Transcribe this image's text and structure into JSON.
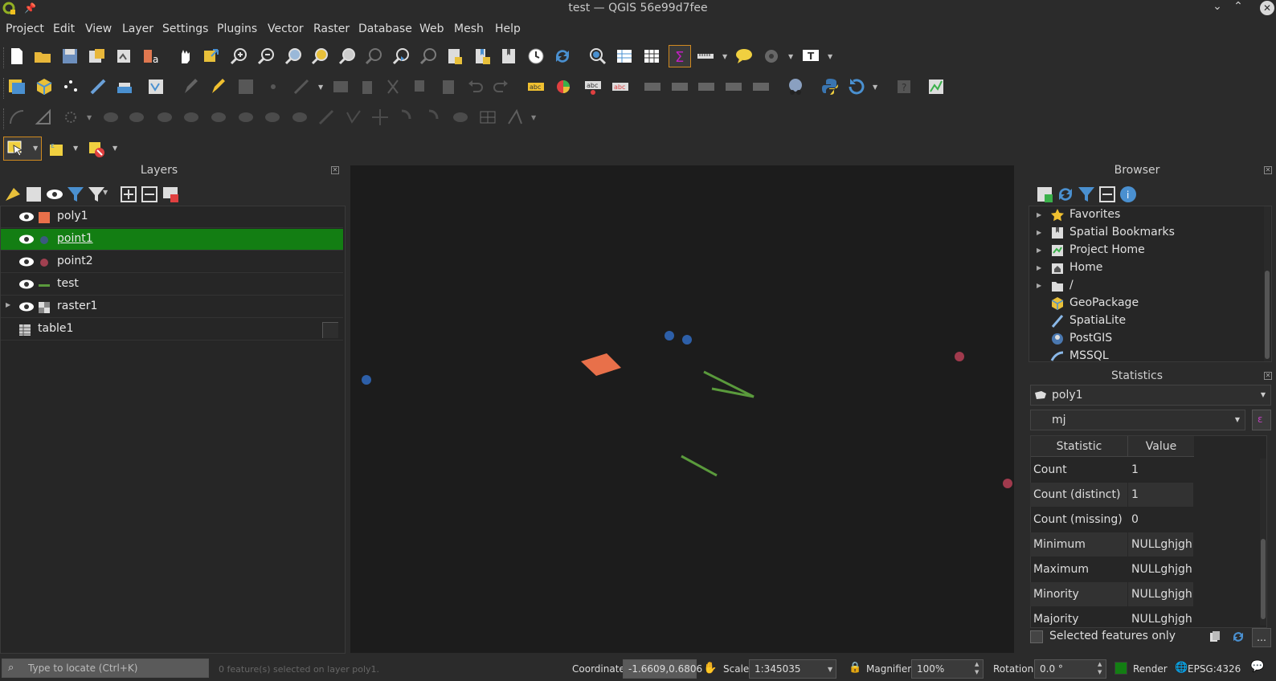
{
  "window": {
    "title": "test — QGIS 56e99d7fee"
  },
  "menu": [
    "Project",
    "Edit",
    "View",
    "Layer",
    "Settings",
    "Plugins",
    "Vector",
    "Raster",
    "Database",
    "Web",
    "Mesh",
    "Help"
  ],
  "layers_panel": {
    "title": "Layers",
    "layers": [
      {
        "name": "poly1",
        "symbol": "polygon",
        "color": "#e8704a",
        "visible": true,
        "selected": false
      },
      {
        "name": "point1",
        "symbol": "point",
        "color": "#3b6ec9",
        "visible": true,
        "selected": true
      },
      {
        "name": "point2",
        "symbol": "point",
        "color": "#a04050",
        "visible": true,
        "selected": false
      },
      {
        "name": "test",
        "symbol": "line",
        "color": "#5a9a3c",
        "visible": true,
        "selected": false
      },
      {
        "name": "raster1",
        "symbol": "raster",
        "color": "#cccccc",
        "visible": true,
        "selected": false
      },
      {
        "name": "table1",
        "symbol": "table",
        "color": "#cccccc",
        "visible": false,
        "selected": false
      }
    ]
  },
  "browser_panel": {
    "title": "Browser",
    "items": [
      {
        "label": "Favorites",
        "icon": "star-icon",
        "expandable": true
      },
      {
        "label": "Spatial Bookmarks",
        "icon": "bookmark-icon",
        "expandable": true
      },
      {
        "label": "Project Home",
        "icon": "project-home-icon",
        "expandable": true
      },
      {
        "label": "Home",
        "icon": "home-icon",
        "expandable": true
      },
      {
        "label": "/",
        "icon": "folder-icon",
        "expandable": true
      },
      {
        "label": "GeoPackage",
        "icon": "geopackage-icon",
        "expandable": false
      },
      {
        "label": "SpatiaLite",
        "icon": "spatialite-icon",
        "expandable": false
      },
      {
        "label": "PostGIS",
        "icon": "postgis-icon",
        "expandable": false
      },
      {
        "label": "MSSQL",
        "icon": "mssql-icon",
        "expandable": false
      }
    ]
  },
  "statistics_panel": {
    "title": "Statistics",
    "layer": "poly1",
    "field": "mj",
    "headers": [
      "Statistic",
      "Value"
    ],
    "rows": [
      [
        "Count",
        "1"
      ],
      [
        "Count (distinct)",
        "1"
      ],
      [
        "Count (missing)",
        "0"
      ],
      [
        "Minimum",
        "NULLghjgh"
      ],
      [
        "Maximum",
        "NULLghjgh"
      ],
      [
        "Minority",
        "NULLghjgh"
      ],
      [
        "Majority",
        "NULLghjgh"
      ]
    ],
    "selected_only_label": "Selected features only"
  },
  "statusbar": {
    "locate_placeholder": "Type to locate (Ctrl+K)",
    "message": "0 feature(s) selected on layer poly1.",
    "coordinate_label": "Coordinate",
    "coordinate": "-1.6609,0.6806",
    "scale_label": "Scale",
    "scale": "1:345035",
    "magnifier_label": "Magnifier",
    "magnifier": "100%",
    "rotation_label": "Rotation",
    "rotation": "0.0 °",
    "render_label": "Render",
    "crs": "EPSG:4326"
  }
}
